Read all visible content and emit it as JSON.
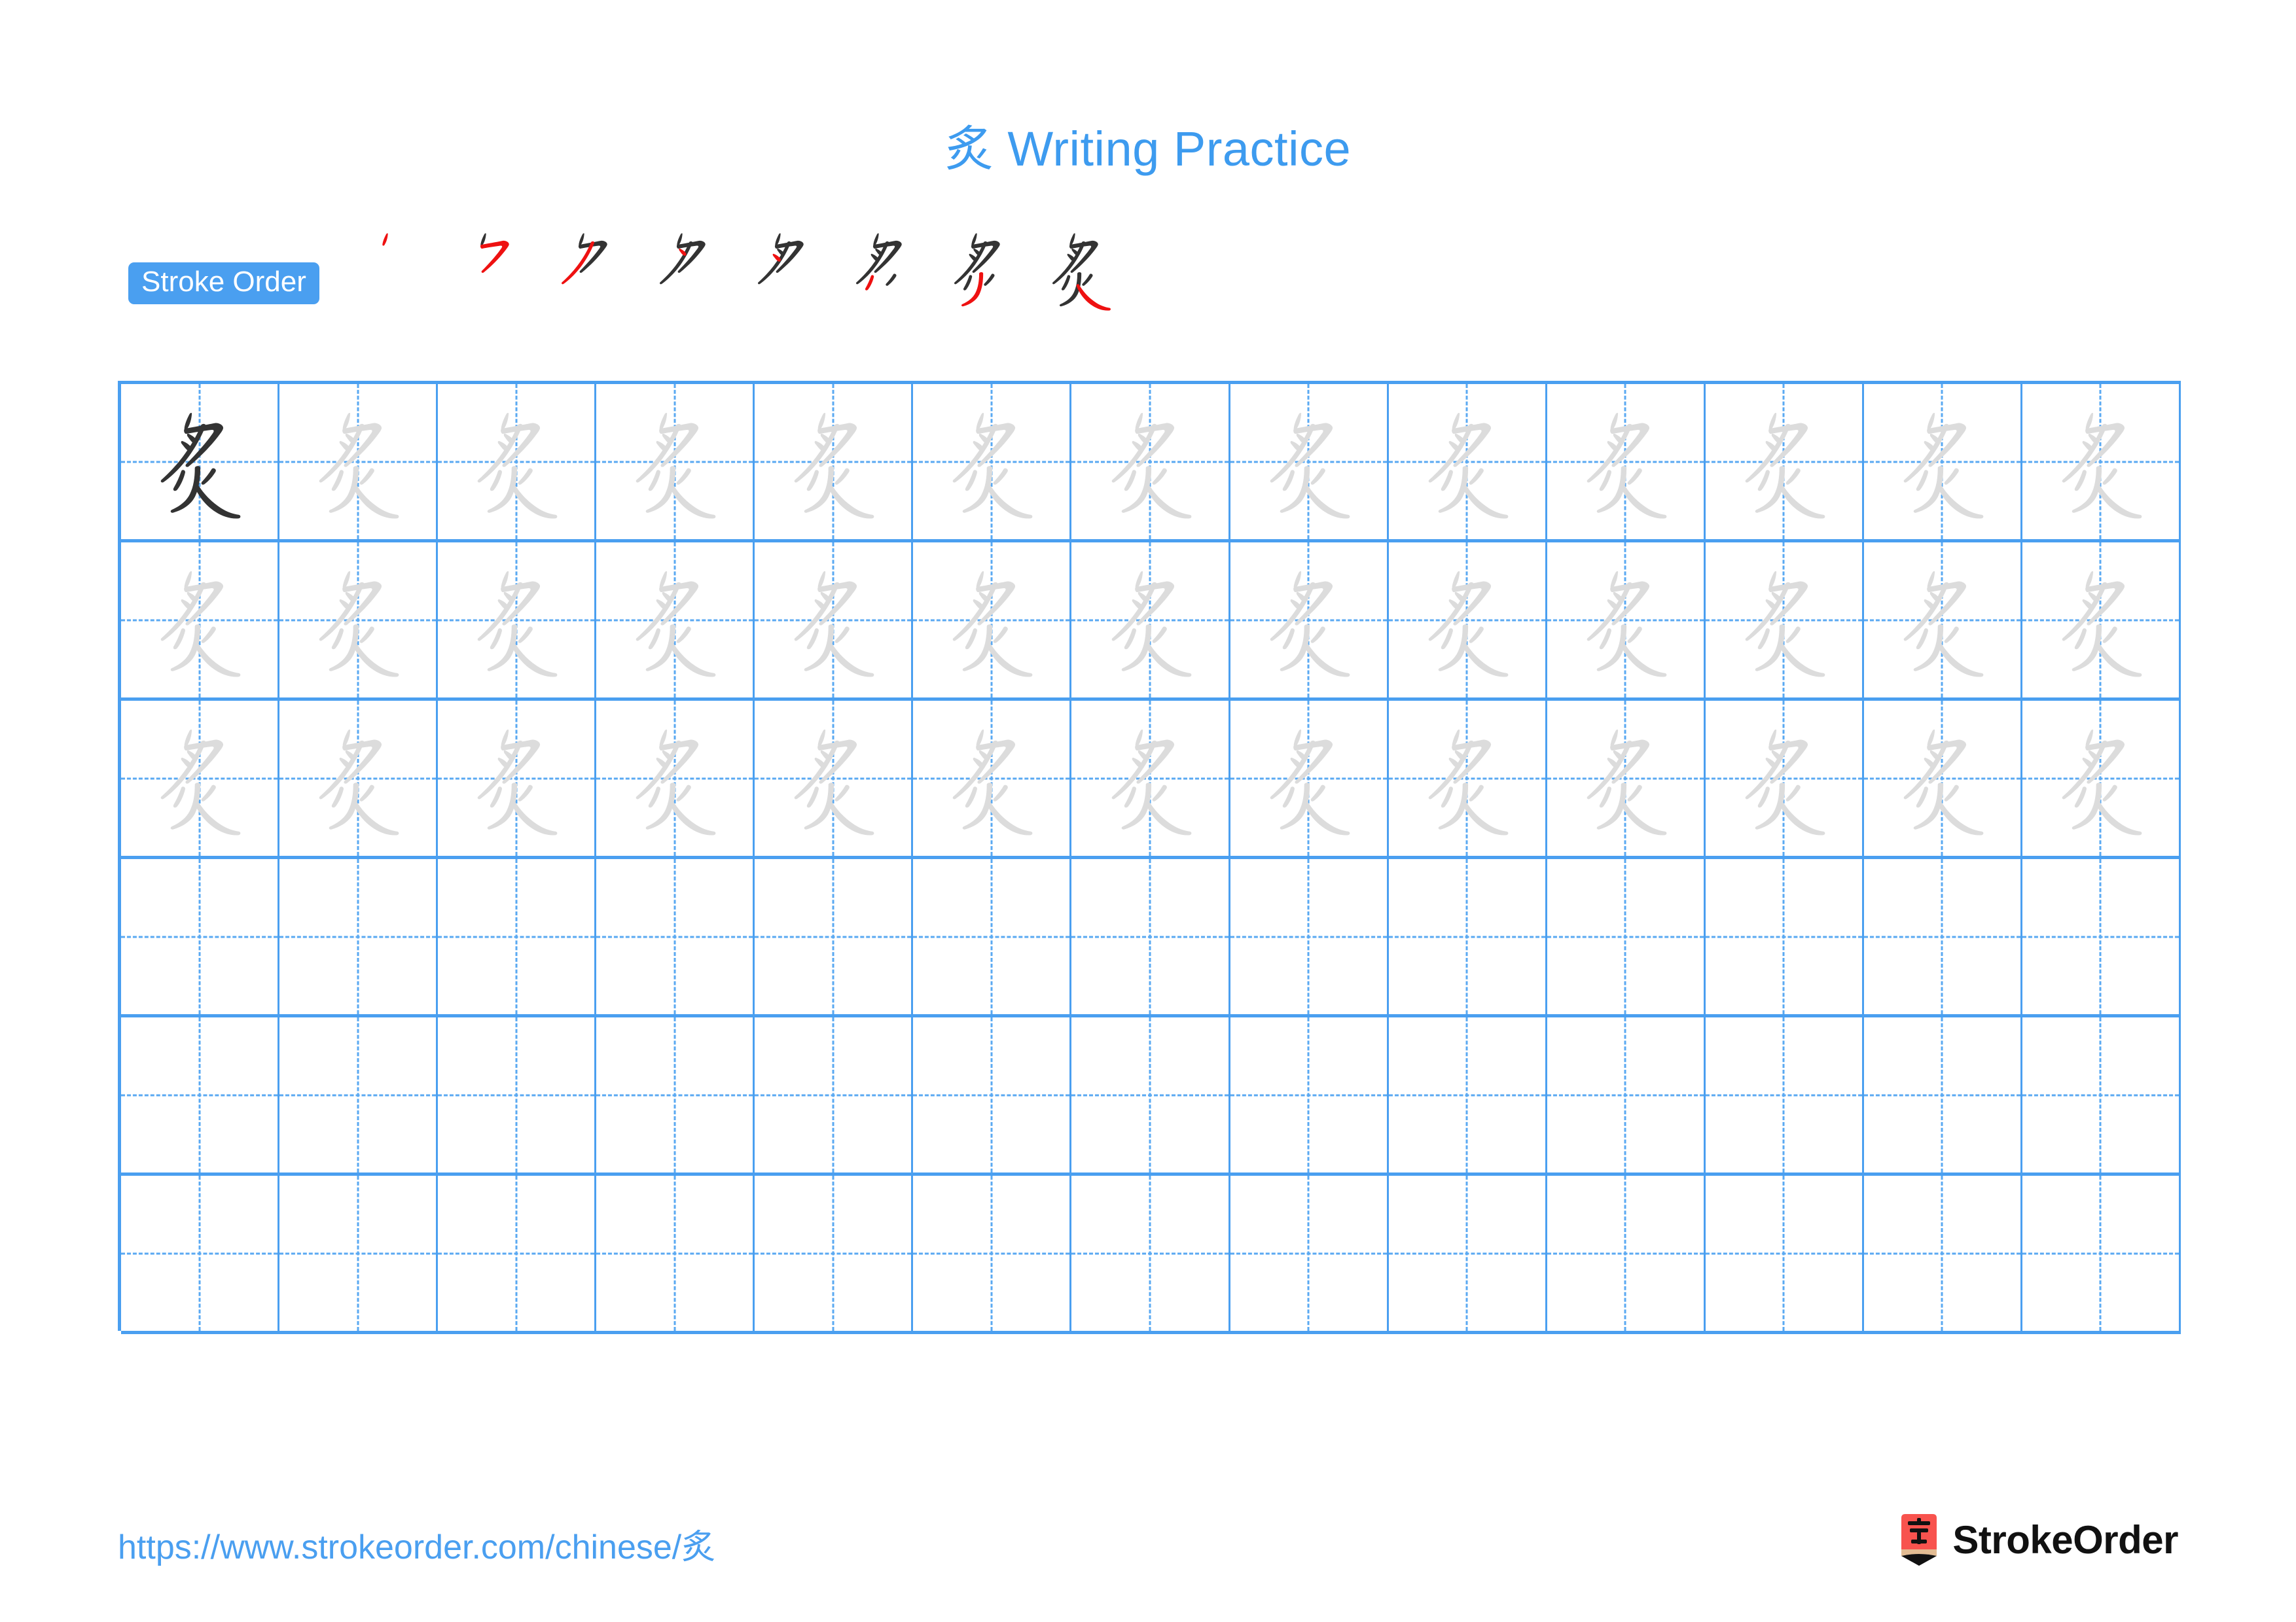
{
  "page": {
    "character": "炙",
    "title": "炙 Writing Practice",
    "background_color": "#ffffff"
  },
  "colors": {
    "accent_blue": "#4a9ff0",
    "title_blue": "#3d9bef",
    "grid_line": "#4a9ff0",
    "grid_guide": "#5aa9f2",
    "trace_gray": "#dcdcdc",
    "ink_dark": "#333333",
    "stroke_highlight_red": "#ee1111",
    "logo_red": "#f8534e",
    "logo_wood": "#e3bc93"
  },
  "stroke_order": {
    "badge_label": "Stroke Order",
    "total_strokes": 8,
    "steps": [
      {
        "index": 1,
        "new_stroke": "㇒ piě"
      },
      {
        "index": 2,
        "new_stroke": "㇆ héngzhégōu"
      },
      {
        "index": 3,
        "new_stroke": "㇒ piě"
      },
      {
        "index": 4,
        "new_stroke": "㇔ diǎn"
      },
      {
        "index": 5,
        "new_stroke": "㇔ diǎn"
      },
      {
        "index": 6,
        "new_stroke": "㇒ piě"
      },
      {
        "index": 7,
        "new_stroke": "㇑ shù"
      },
      {
        "index": 8,
        "new_stroke": "㇏ nà"
      }
    ]
  },
  "grid": {
    "columns": 13,
    "rows": 6,
    "rows_data": [
      {
        "row": 1,
        "cells": [
          "ink",
          "trace",
          "trace",
          "trace",
          "trace",
          "trace",
          "trace",
          "trace",
          "trace",
          "trace",
          "trace",
          "trace",
          "trace"
        ]
      },
      {
        "row": 2,
        "cells": [
          "trace",
          "trace",
          "trace",
          "trace",
          "trace",
          "trace",
          "trace",
          "trace",
          "trace",
          "trace",
          "trace",
          "trace",
          "trace"
        ]
      },
      {
        "row": 3,
        "cells": [
          "trace",
          "trace",
          "trace",
          "trace",
          "trace",
          "trace",
          "trace",
          "trace",
          "trace",
          "trace",
          "trace",
          "trace",
          "trace"
        ]
      },
      {
        "row": 4,
        "cells": [
          "empty",
          "empty",
          "empty",
          "empty",
          "empty",
          "empty",
          "empty",
          "empty",
          "empty",
          "empty",
          "empty",
          "empty",
          "empty"
        ]
      },
      {
        "row": 5,
        "cells": [
          "empty",
          "empty",
          "empty",
          "empty",
          "empty",
          "empty",
          "empty",
          "empty",
          "empty",
          "empty",
          "empty",
          "empty",
          "empty"
        ]
      },
      {
        "row": 6,
        "cells": [
          "empty",
          "empty",
          "empty",
          "empty",
          "empty",
          "empty",
          "empty",
          "empty",
          "empty",
          "empty",
          "empty",
          "empty",
          "empty"
        ]
      }
    ]
  },
  "footer": {
    "url": "https://www.strokeorder.com/chinese/炙",
    "brand_name": "StrokeOrder",
    "logo_character": "字"
  }
}
